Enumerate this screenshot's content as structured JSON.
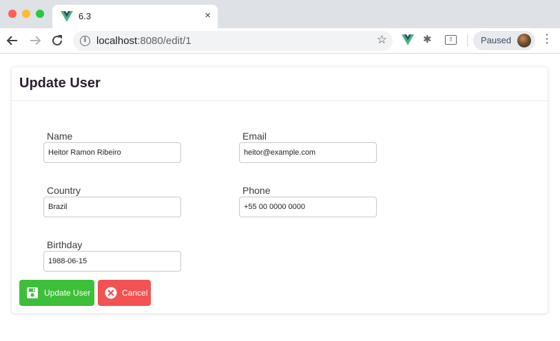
{
  "browser": {
    "tab_title": "6.3",
    "tab_close": "×",
    "url_host": "localhost",
    "url_rest": ":8080/edit/1",
    "profile_status": "Paused",
    "icons": [
      "back-arrow-icon",
      "forward-arrow-icon",
      "reload-icon",
      "info-icon",
      "star-icon",
      "vue-devtools-icon",
      "bug-icon",
      "extension-icon",
      "avatar",
      "kebab-menu-icon"
    ]
  },
  "page": {
    "title": "Update User",
    "fields": {
      "name": {
        "label": "Name",
        "value": "Heitor Ramon Ribeiro"
      },
      "email": {
        "label": "Email",
        "value": "heitor@example.com"
      },
      "country": {
        "label": "Country",
        "value": "Brazil"
      },
      "phone": {
        "label": "Phone",
        "value": "+55 00 0000 0000"
      },
      "birthday": {
        "label": "Birthday",
        "value": "1988-06-15"
      }
    },
    "buttons": {
      "update": "Update User",
      "cancel": "Cancel"
    }
  },
  "colors": {
    "update_button": "#3dbf3a",
    "cancel_button": "#f25252",
    "vue_green": "#41b883",
    "vue_dark": "#35495e"
  }
}
